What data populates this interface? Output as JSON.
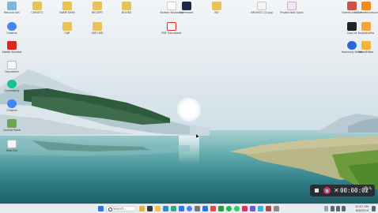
{
  "desktop_icons": [
    {
      "label": "Recycle Bin",
      "icon": "recycle-bin-icon",
      "color": "#7fb6d9"
    },
    {
      "label": "CHRISTO",
      "icon": "folder-icon",
      "color": "#e8c35a"
    },
    {
      "label": "BANK DATA",
      "icon": "folder-icon",
      "color": "#e8c35a"
    },
    {
      "label": "RECEIPT",
      "icon": "folder-icon",
      "color": "#e8c35a"
    },
    {
      "label": "BOOKS",
      "icon": "folder-icon",
      "color": "#e8c35a"
    },
    {
      "label": "Korean Keyboard",
      "icon": "korea-flag-icon",
      "color": "#ffffff"
    },
    {
      "label": "Lightroom",
      "icon": "lightroom-icon",
      "color": "#1b2a44"
    },
    {
      "label": "NO",
      "icon": "folder-icon",
      "color": "#e8c35a"
    },
    {
      "label": "IMG0001 (1).jpg",
      "icon": "image-file-icon",
      "color": "#f4f4f4"
    },
    {
      "label": "Project Bell Signs",
      "icon": "pdf-file-icon",
      "color": "#f0e6f4"
    },
    {
      "label": "GameLauncher",
      "icon": "game-icon",
      "color": "#c9524b"
    },
    {
      "label": "VLC media player",
      "icon": "vlc-icon",
      "color": "#f08a1c"
    },
    {
      "label": "Chrome",
      "icon": "chrome-icon",
      "color": "#4285f4"
    },
    {
      "label": "CAR",
      "icon": "folder-icon",
      "color": "#e8c35a"
    },
    {
      "label": "USE LIKE",
      "icon": "folder-icon",
      "color": "#e8c35a"
    },
    {
      "label": "PDF Document",
      "icon": "pdf-icon",
      "color": "#d93025"
    },
    {
      "label": "CapCut",
      "icon": "capcut-icon",
      "color": "#222222"
    },
    {
      "label": "AnalyticsPro",
      "icon": "analytics-icon",
      "color": "#f3a43b"
    },
    {
      "label": "Adobe Acrobat",
      "icon": "acrobat-icon",
      "color": "#d9271f"
    },
    {
      "label": "Samsung Notes",
      "icon": "notes-icon",
      "color": "#2d68d8"
    },
    {
      "label": "WaveEditor",
      "icon": "wave-icon",
      "color": "#f3b43b"
    },
    {
      "label": "Document",
      "icon": "document-icon",
      "color": "#f6f6f6"
    },
    {
      "label": "Grammarly",
      "icon": "grammarly-icon",
      "color": "#15c39a"
    },
    {
      "label": "Chrome",
      "icon": "chrome-icon",
      "color": "#4285f4"
    },
    {
      "label": "Control Panel",
      "icon": "control-panel-icon",
      "color": "#6aa84f"
    },
    {
      "label": "New File",
      "icon": "document-icon",
      "color": "#f6f6f6"
    }
  ],
  "taskbar": {
    "search_placeholder": "Search",
    "clock_time": "10:07 AM",
    "clock_date": "8/8/2024",
    "apps": [
      {
        "icon": "windows-icon",
        "color": "#2b78d8"
      },
      {
        "icon": "widgets-icon",
        "color": "#e1b04a"
      },
      {
        "icon": "task-view-icon",
        "color": "#3b3b3b"
      },
      {
        "icon": "file-explorer-icon",
        "color": "#f0c04a"
      },
      {
        "icon": "store-icon",
        "color": "#2a8bd8"
      },
      {
        "icon": "edge-icon",
        "color": "#2faa7a"
      },
      {
        "icon": "photos-icon",
        "color": "#2d7be0"
      },
      {
        "icon": "chrome-icon",
        "color": "#4285f4"
      },
      {
        "icon": "settings-icon",
        "color": "#777777"
      },
      {
        "icon": "mail-icon",
        "color": "#2b78d8"
      },
      {
        "icon": "calendar-icon",
        "color": "#e04848"
      },
      {
        "icon": "xbox-icon",
        "color": "#2a9a3a"
      },
      {
        "icon": "spotify-icon",
        "color": "#1db954"
      },
      {
        "icon": "whatsapp-icon",
        "color": "#25d366"
      },
      {
        "icon": "recorder-icon",
        "color": "#e0306c"
      }
    ]
  },
  "recorder": {
    "elapsed": "00:00:02"
  }
}
